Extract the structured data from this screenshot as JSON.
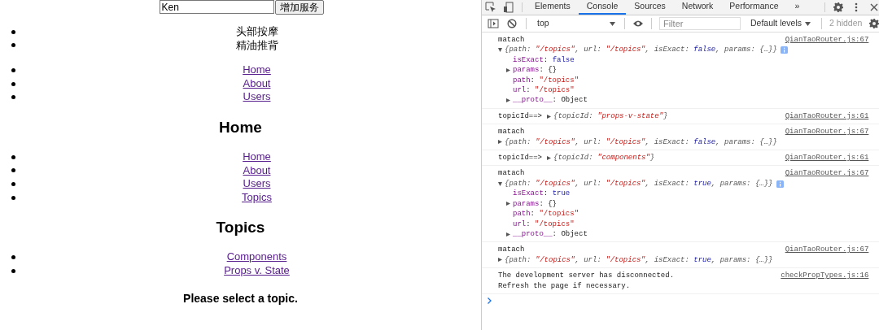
{
  "app": {
    "name_field": {
      "value": "Ken"
    },
    "add_button": "增加服务",
    "services": [
      "头部按摩",
      "精油推背"
    ],
    "nav_links": [
      "Home",
      "About",
      "Users"
    ],
    "home_heading": "Home",
    "home_links": [
      "Home",
      "About",
      "Users",
      "Topics"
    ],
    "topics_heading": "Topics",
    "topic_links": [
      "Components",
      "Props v. State"
    ],
    "topic_prompt": "Please select a topic."
  },
  "devtools": {
    "tabs": [
      {
        "label": "Elements",
        "selected": false
      },
      {
        "label": "Console",
        "selected": true
      },
      {
        "label": "Sources",
        "selected": false
      },
      {
        "label": "Network",
        "selected": false
      },
      {
        "label": "Performance",
        "selected": false
      }
    ],
    "more_tabs": "»",
    "toolbar": {
      "context": "top",
      "filter": {
        "placeholder": "Filter"
      },
      "levels": "Default levels",
      "hidden_count": "2 hidden"
    },
    "messages": [
      {
        "kind": "object-block",
        "label": "matach",
        "source": "QianTaoRouter.js:67",
        "object": {
          "expanded": true,
          "summary": [
            {
              "kind": "key",
              "text": "{path: "
            },
            {
              "kind": "string",
              "text": "\"/topics\""
            },
            {
              "kind": "key",
              "text": ", url: "
            },
            {
              "kind": "string",
              "text": "\"/topics\""
            },
            {
              "kind": "key",
              "text": ", isExact: "
            },
            {
              "kind": "bool",
              "text": "false"
            },
            {
              "kind": "key",
              "text": ", params: {…}}"
            }
          ],
          "properties": [
            {
              "key": "isExact",
              "separator": ": ",
              "value": "false",
              "kind": "bool",
              "expandable": false
            },
            {
              "key": "params",
              "separator": ": ",
              "value": "{}",
              "kind": "plain",
              "expandable": true
            },
            {
              "key": "path",
              "separator": ": ",
              "value": "\"/topics\"",
              "kind": "string",
              "expandable": false
            },
            {
              "key": "url",
              "separator": ": ",
              "value": "\"/topics\"",
              "kind": "string",
              "expandable": false
            },
            {
              "key": "__proto__",
              "separator": ": ",
              "value": "Object",
              "kind": "plain",
              "expandable": true
            }
          ]
        }
      },
      {
        "kind": "object-inline",
        "label": "topicId==>",
        "source": "QianTaoRouter.js:61",
        "object": {
          "expanded": false,
          "summary": [
            {
              "kind": "key",
              "text": "{topicId: "
            },
            {
              "kind": "string",
              "text": "\"props-v-state\""
            },
            {
              "kind": "key",
              "text": "}"
            }
          ]
        }
      },
      {
        "kind": "object-block",
        "label": "matach",
        "source": "QianTaoRouter.js:67",
        "object": {
          "expanded": false,
          "summary": [
            {
              "kind": "key",
              "text": "{path: "
            },
            {
              "kind": "string",
              "text": "\"/topics\""
            },
            {
              "kind": "key",
              "text": ", url: "
            },
            {
              "kind": "string",
              "text": "\"/topics\""
            },
            {
              "kind": "key",
              "text": ", isExact: "
            },
            {
              "kind": "bool",
              "text": "false"
            },
            {
              "kind": "key",
              "text": ", params: {…}}"
            }
          ]
        }
      },
      {
        "kind": "object-inline",
        "label": "topicId==>",
        "source": "QianTaoRouter.js:61",
        "object": {
          "expanded": false,
          "summary": [
            {
              "kind": "key",
              "text": "{topicId: "
            },
            {
              "kind": "string",
              "text": "\"components\""
            },
            {
              "kind": "key",
              "text": "}"
            }
          ]
        }
      },
      {
        "kind": "object-block",
        "label": "matach",
        "source": "QianTaoRouter.js:67",
        "object": {
          "expanded": true,
          "summary": [
            {
              "kind": "key",
              "text": "{path: "
            },
            {
              "kind": "string",
              "text": "\"/topics\""
            },
            {
              "kind": "key",
              "text": ", url: "
            },
            {
              "kind": "string",
              "text": "\"/topics\""
            },
            {
              "kind": "key",
              "text": ", isExact: "
            },
            {
              "kind": "bool",
              "text": "true"
            },
            {
              "kind": "key",
              "text": ", params: {…}}"
            }
          ],
          "properties": [
            {
              "key": "isExact",
              "separator": ": ",
              "value": "true",
              "kind": "bool",
              "expandable": false
            },
            {
              "key": "params",
              "separator": ": ",
              "value": "{}",
              "kind": "plain",
              "expandable": true
            },
            {
              "key": "path",
              "separator": ": ",
              "value": "\"/topics\"",
              "kind": "string",
              "expandable": false
            },
            {
              "key": "url",
              "separator": ": ",
              "value": "\"/topics\"",
              "kind": "string",
              "expandable": false
            },
            {
              "key": "__proto__",
              "separator": ": ",
              "value": "Object",
              "kind": "plain",
              "expandable": true
            }
          ]
        }
      },
      {
        "kind": "object-block",
        "label": "matach",
        "source": "QianTaoRouter.js:67",
        "object": {
          "expanded": false,
          "summary": [
            {
              "kind": "key",
              "text": "{path: "
            },
            {
              "kind": "string",
              "text": "\"/topics\""
            },
            {
              "kind": "key",
              "text": ", url: "
            },
            {
              "kind": "string",
              "text": "\"/topics\""
            },
            {
              "kind": "key",
              "text": ", isExact: "
            },
            {
              "kind": "bool",
              "text": "true"
            },
            {
              "kind": "key",
              "text": ", params: {…}}"
            }
          ]
        }
      },
      {
        "kind": "text",
        "lines": [
          "The development server has disconnected.",
          "Refresh the page if necessary."
        ],
        "source": "checkPropTypes.js:16"
      }
    ]
  }
}
